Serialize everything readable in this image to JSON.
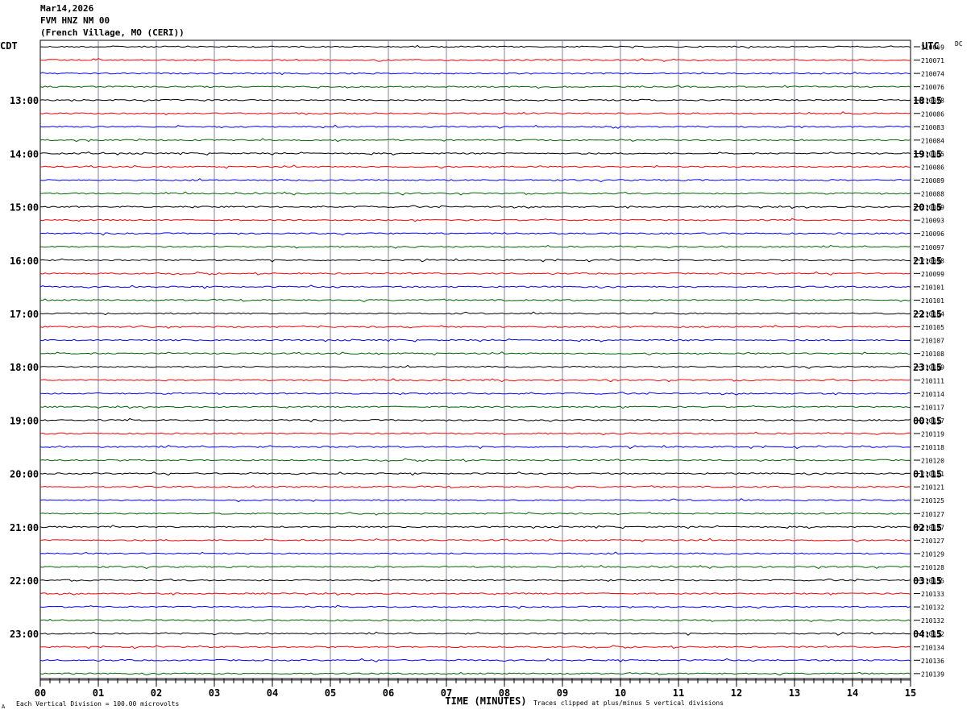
{
  "header": {
    "date": "Mar14,2026",
    "station": "FVM HNZ NM 00",
    "location": "(French Village, MO (CERI))"
  },
  "chart_data": {
    "type": "line",
    "title": "",
    "left_timezone_label": "CDT",
    "right_timezone_label": "UTC",
    "dc_header": "DC",
    "xlabel": "TIME (MINUTES)",
    "x_ticks": [
      "00",
      "01",
      "02",
      "03",
      "04",
      "05",
      "06",
      "07",
      "08",
      "09",
      "10",
      "11",
      "12",
      "13",
      "14",
      "15"
    ],
    "xlim": [
      0,
      15
    ],
    "left_hour_labels": [
      "13:00",
      "14:00",
      "15:00",
      "16:00",
      "17:00",
      "18:00",
      "19:00",
      "20:00",
      "21:00",
      "22:00",
      "23:00"
    ],
    "right_hour_labels": [
      "18:15",
      "19:15",
      "20:15",
      "21:15",
      "22:15",
      "23:15",
      "00:15",
      "01:15",
      "02:15",
      "03:15",
      "04:15"
    ],
    "trace_colors": [
      "#000000",
      "#ff0000",
      "#0000ff",
      "#006400"
    ],
    "dc_offsets": [
      "210069",
      "210071",
      "210074",
      "210076",
      "210078",
      "210086",
      "210083",
      "210084",
      "210085",
      "210086",
      "210089",
      "210088",
      "210089",
      "210093",
      "210096",
      "210097",
      "210098",
      "210099",
      "210101",
      "210101",
      "210104",
      "210105",
      "210107",
      "210108",
      "210109",
      "210111",
      "210114",
      "210117",
      "210117",
      "210119",
      "210118",
      "210120",
      "210121",
      "210121",
      "210125",
      "210127",
      "210127",
      "210127",
      "210129",
      "210128",
      "210135",
      "210133",
      "210132",
      "210132",
      "210132",
      "210134",
      "210136",
      "210139"
    ],
    "footer_scale": "Each Vertical Division =  100.00 microvolts",
    "footer_clip": "Traces clipped at plus/minus 5 vertical divisions",
    "footer_mark": "A"
  }
}
